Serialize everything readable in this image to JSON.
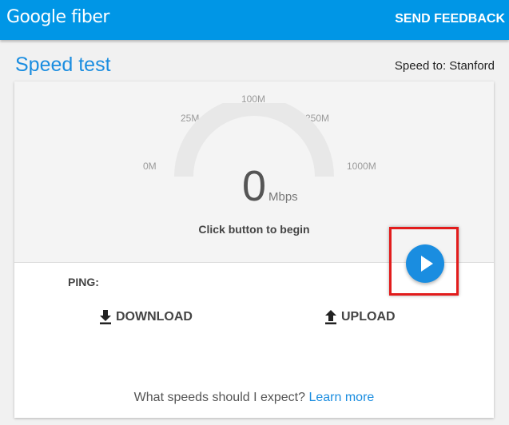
{
  "header": {
    "logo_text": "Google fiber",
    "feedback_label": "SEND FEEDBACK"
  },
  "page": {
    "title": "Speed test",
    "speed_to": "Speed to: Stanford"
  },
  "gauge": {
    "ticks": [
      "0M",
      "25M",
      "100M",
      "250M",
      "1000M"
    ],
    "value": "0",
    "unit": "Mbps",
    "hint": "Click button to begin"
  },
  "results": {
    "ping_label": "PING:",
    "download_label": "DOWNLOAD",
    "upload_label": "UPLOAD"
  },
  "footer": {
    "question": "What speeds should I expect?",
    "link_label": "Learn more"
  },
  "colors": {
    "topbar": "#0096e6",
    "accent": "#1a8de0",
    "highlight": "#e21c1c"
  }
}
